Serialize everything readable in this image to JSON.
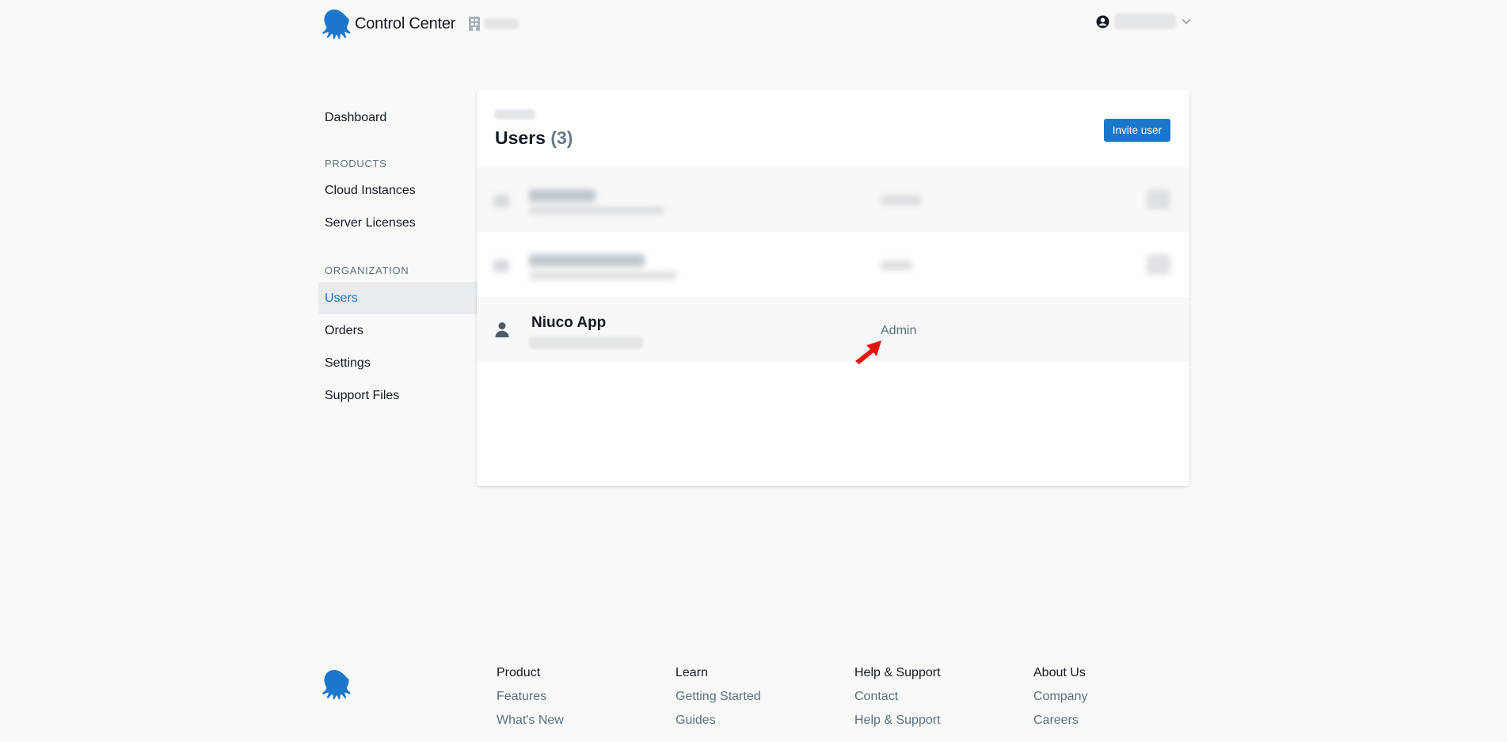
{
  "header": {
    "app_title": "Control Center",
    "icons": {
      "logo": "octopus-logo-icon",
      "org": "building-icon",
      "account": "user-circle-icon",
      "dropdown": "chevron-down-icon"
    }
  },
  "sidebar": {
    "dashboard": "Dashboard",
    "products_heading": "PRODUCTS",
    "products": [
      "Cloud Instances",
      "Server Licenses"
    ],
    "organization_heading": "ORGANIZATION",
    "organization": [
      "Users",
      "Orders",
      "Settings",
      "Support Files"
    ],
    "active_item": "Users"
  },
  "main": {
    "title": "Users",
    "count": "(3)",
    "invite_button": "Invite user",
    "users": [
      {
        "redacted": true
      },
      {
        "redacted": true
      },
      {
        "name": "Niuco App",
        "role": "Admin",
        "redacted": false
      }
    ]
  },
  "footer": {
    "columns": [
      {
        "heading": "Product",
        "links": [
          "Features",
          "What's New"
        ]
      },
      {
        "heading": "Learn",
        "links": [
          "Getting Started",
          "Guides"
        ]
      },
      {
        "heading": "Help & Support",
        "links": [
          "Contact",
          "Help & Support"
        ]
      },
      {
        "heading": "About Us",
        "links": [
          "Company",
          "Careers"
        ]
      }
    ]
  },
  "colors": {
    "accent": "#1a77ca",
    "annotation_arrow": "#e8120c",
    "background": "#f8f9f9"
  }
}
